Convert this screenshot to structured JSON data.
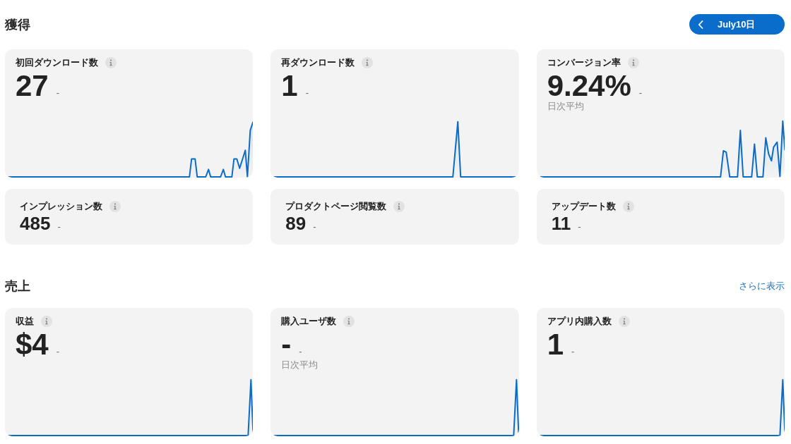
{
  "sections": [
    {
      "title": "獲得",
      "action": {
        "kind": "date",
        "label": "July10日"
      },
      "cards": [
        {
          "kind": "chart",
          "title": "初回ダウンロード数",
          "value": "27",
          "delta": "-"
        },
        {
          "kind": "chart",
          "title": "再ダウンロード数",
          "value": "1",
          "delta": "-"
        },
        {
          "kind": "chart",
          "title": "コンバージョン率",
          "value": "9.24%",
          "delta": "-",
          "note": "日次平均"
        },
        {
          "kind": "compact",
          "title": "インプレッション数",
          "value": "485",
          "delta": "-"
        },
        {
          "kind": "compact",
          "title": "プロダクトページ閲覧数",
          "value": "89",
          "delta": "-"
        },
        {
          "kind": "compact",
          "title": "アップデート数",
          "value": "11",
          "delta": "-"
        }
      ]
    },
    {
      "title": "売上",
      "action": {
        "kind": "link",
        "label": "さらに表示"
      },
      "cards": [
        {
          "kind": "chart",
          "title": "収益",
          "value": "$4",
          "delta": "-"
        },
        {
          "kind": "chart",
          "title": "購入ユーザ数",
          "value": "-",
          "delta": "-",
          "note": "日次平均"
        },
        {
          "kind": "chart",
          "title": "アプリ内購入数",
          "value": "1",
          "delta": "-"
        }
      ]
    }
  ]
}
